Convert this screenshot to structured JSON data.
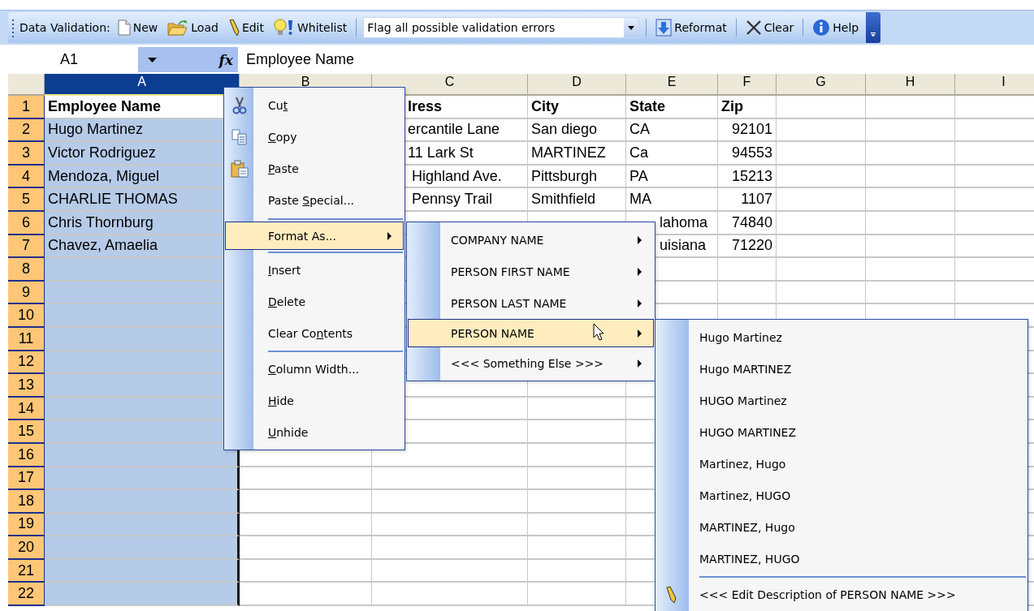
{
  "toolbar": {
    "label": "Data Validation:",
    "buttons": [
      {
        "kind": "new",
        "label": "New"
      },
      {
        "kind": "load",
        "label": "Load"
      },
      {
        "kind": "edit",
        "label": "Edit"
      },
      {
        "kind": "whitelist",
        "label": "Whitelist"
      }
    ],
    "mode_select": {
      "value": "Flag all possible validation errors"
    },
    "actions": [
      {
        "kind": "reformat",
        "label": "Reformat"
      },
      {
        "kind": "clear",
        "label": "Clear"
      },
      {
        "kind": "help",
        "label": "Help"
      }
    ]
  },
  "formula_bar": {
    "cell": "A1",
    "fx_label": "fx",
    "formula": "Employee Name"
  },
  "sheet": {
    "columns": [
      {
        "label": "A",
        "selected": true
      },
      {
        "label": "B",
        "selected": false
      },
      {
        "label": "C",
        "selected": false
      },
      {
        "label": "D",
        "selected": false
      },
      {
        "label": "E",
        "selected": false
      },
      {
        "label": "F",
        "selected": false
      },
      {
        "label": "G",
        "selected": false
      },
      {
        "label": "H",
        "selected": false
      },
      {
        "label": "I",
        "selected": false
      }
    ],
    "rows": [
      {
        "label": "1",
        "cells": [
          "Employee Name",
          "",
          "lress",
          "City",
          "State",
          "Zip",
          "",
          "",
          ""
        ]
      },
      {
        "label": "2",
        "cells": [
          "Hugo Martinez",
          "",
          "ercantile Lane",
          "San diego",
          "CA",
          "92101",
          "",
          "",
          ""
        ]
      },
      {
        "label": "3",
        "cells": [
          "Victor Rodriguez",
          "",
          "11 Lark St",
          "MARTINEZ",
          "Ca",
          "94553",
          "",
          "",
          ""
        ]
      },
      {
        "label": "4",
        "cells": [
          "Mendoza, Miguel",
          "",
          " Highland Ave.",
          "Pittsburgh",
          "PA",
          "15213",
          "",
          "",
          ""
        ]
      },
      {
        "label": "5",
        "cells": [
          "CHARLIE THOMAS",
          "",
          " Pennsy Trail",
          "Smithfield",
          "MA",
          "1107",
          "",
          "",
          ""
        ]
      },
      {
        "label": "6",
        "cells": [
          "Chris Thornburg",
          "",
          "",
          "",
          "lahoma",
          "74840",
          "",
          "",
          ""
        ]
      },
      {
        "label": "7",
        "cells": [
          "Chavez, Amaelia",
          "",
          "",
          "",
          "uisiana",
          "71220",
          "",
          "",
          ""
        ]
      },
      {
        "label": "8",
        "cells": [
          "",
          "",
          "",
          "",
          "",
          "",
          "",
          "",
          ""
        ]
      },
      {
        "label": "9",
        "cells": [
          "",
          "",
          "",
          "",
          "",
          "",
          "",
          "",
          ""
        ]
      },
      {
        "label": "10",
        "cells": [
          "",
          "",
          "",
          "",
          "",
          "",
          "",
          "",
          ""
        ]
      },
      {
        "label": "11",
        "cells": [
          "",
          "",
          "",
          "",
          "",
          "",
          "",
          "",
          ""
        ]
      },
      {
        "label": "12",
        "cells": [
          "",
          "",
          "",
          "",
          "",
          "",
          "",
          "",
          ""
        ]
      },
      {
        "label": "13",
        "cells": [
          "",
          "",
          "",
          "",
          "",
          "",
          "",
          "",
          ""
        ]
      },
      {
        "label": "14",
        "cells": [
          "",
          "",
          "",
          "",
          "",
          "",
          "",
          "",
          ""
        ]
      },
      {
        "label": "15",
        "cells": [
          "",
          "",
          "",
          "",
          "",
          "",
          "",
          "",
          ""
        ]
      },
      {
        "label": "16",
        "cells": [
          "",
          "",
          "",
          "",
          "",
          "",
          "",
          "",
          ""
        ]
      },
      {
        "label": "17",
        "cells": [
          "",
          "",
          "",
          "",
          "",
          "",
          "",
          "",
          ""
        ]
      },
      {
        "label": "18",
        "cells": [
          "",
          "",
          "",
          "",
          "",
          "",
          "",
          "",
          ""
        ]
      },
      {
        "label": "19",
        "cells": [
          "",
          "",
          "",
          "",
          "",
          "",
          "",
          "",
          ""
        ]
      },
      {
        "label": "20",
        "cells": [
          "",
          "",
          "",
          "",
          "",
          "",
          "",
          "",
          ""
        ]
      },
      {
        "label": "21",
        "cells": [
          "",
          "",
          "",
          "",
          "",
          "",
          "",
          "",
          ""
        ]
      },
      {
        "label": "22",
        "cells": [
          "",
          "",
          "",
          "",
          "",
          "",
          "",
          "",
          ""
        ]
      }
    ]
  },
  "context_menu": {
    "items": [
      {
        "kind": "command",
        "selected": false,
        "label": [
          {
            "text": "Cu",
            "underline": false
          },
          {
            "text": "t",
            "underline": true
          }
        ]
      },
      {
        "kind": "command",
        "selected": false,
        "label": [
          {
            "text": "C",
            "underline": true
          },
          {
            "text": "opy",
            "underline": false
          }
        ]
      },
      {
        "kind": "command",
        "selected": false,
        "label": [
          {
            "text": "P",
            "underline": true
          },
          {
            "text": "aste",
            "underline": false
          }
        ]
      },
      {
        "kind": "command",
        "selected": false,
        "label": [
          {
            "text": "Paste ",
            "underline": false
          },
          {
            "text": "S",
            "underline": true
          },
          {
            "text": "pecial...",
            "underline": false
          }
        ]
      },
      {
        "kind": "separator"
      },
      {
        "kind": "submenu",
        "selected": true,
        "label": [
          {
            "text": "Format As...",
            "underline": false
          }
        ]
      },
      {
        "kind": "separator"
      },
      {
        "kind": "command",
        "selected": false,
        "label": [
          {
            "text": "I",
            "underline": true
          },
          {
            "text": "nsert",
            "underline": false
          }
        ]
      },
      {
        "kind": "command",
        "selected": false,
        "label": [
          {
            "text": "D",
            "underline": true
          },
          {
            "text": "elete",
            "underline": false
          }
        ]
      },
      {
        "kind": "command",
        "selected": false,
        "label": [
          {
            "text": "Clear Co",
            "underline": false
          },
          {
            "text": "n",
            "underline": true
          },
          {
            "text": "tents",
            "underline": false
          }
        ]
      },
      {
        "kind": "separator"
      },
      {
        "kind": "command",
        "selected": false,
        "label": [
          {
            "text": "C",
            "underline": true
          },
          {
            "text": "olumn Width...",
            "underline": false
          }
        ]
      },
      {
        "kind": "command",
        "selected": false,
        "label": [
          {
            "text": "H",
            "underline": true
          },
          {
            "text": "ide",
            "underline": false
          }
        ]
      },
      {
        "kind": "command",
        "selected": false,
        "label": [
          {
            "text": "U",
            "underline": true
          },
          {
            "text": "nhide",
            "underline": false
          }
        ]
      }
    ]
  },
  "format_submenu": {
    "items": [
      {
        "label": "COMPANY NAME",
        "selected": false
      },
      {
        "label": "PERSON FIRST NAME",
        "selected": false
      },
      {
        "label": "PERSON LAST NAME",
        "selected": false
      },
      {
        "label": "PERSON NAME",
        "selected": true
      },
      {
        "label": "<<< Something Else >>>",
        "selected": false
      }
    ]
  },
  "person_name_submenu": {
    "items": [
      {
        "kind": "option",
        "label": "Hugo Martinez"
      },
      {
        "kind": "option",
        "label": "Hugo MARTINEZ"
      },
      {
        "kind": "option",
        "label": "HUGO Martinez"
      },
      {
        "kind": "option",
        "label": "HUGO MARTINEZ"
      },
      {
        "kind": "option",
        "label": "Martinez, Hugo"
      },
      {
        "kind": "option",
        "label": "Martinez, HUGO"
      },
      {
        "kind": "option",
        "label": "MARTINEZ, Hugo"
      },
      {
        "kind": "option",
        "label": "MARTINEZ, HUGO"
      },
      {
        "kind": "separator"
      },
      {
        "kind": "edit",
        "label": "<<< Edit Description of PERSON NAME >>>"
      }
    ]
  }
}
